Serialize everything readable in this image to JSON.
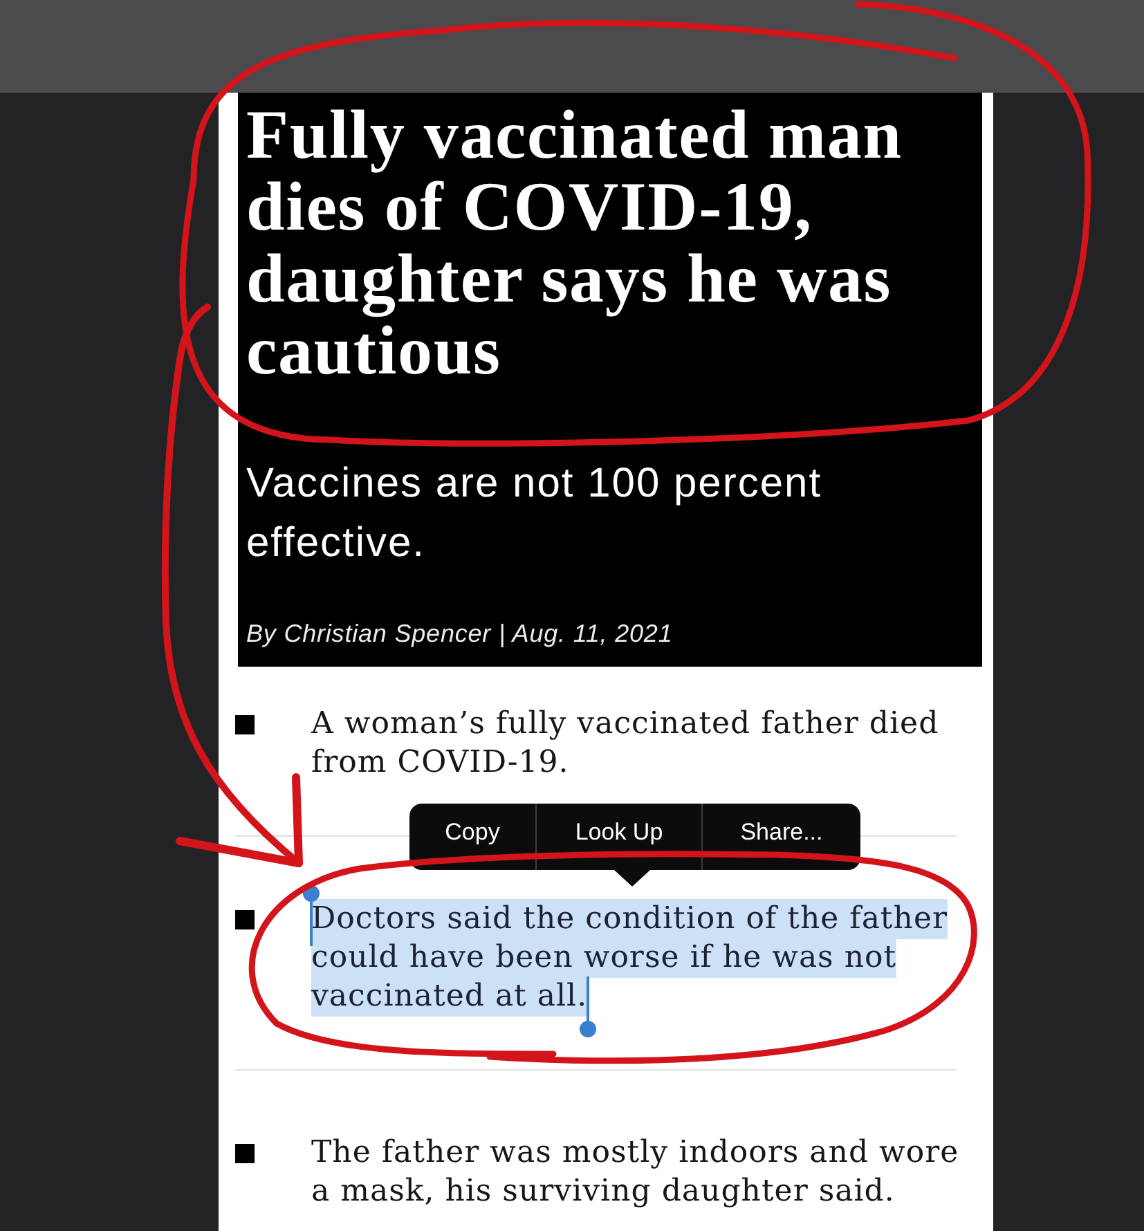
{
  "article": {
    "headline": "Fully vaccinated man dies of COVID-19, daughter says he was cautious",
    "subtitle": "Vaccines are not 100 percent effective.",
    "byline": "By Christian Spencer | Aug. 11, 2021"
  },
  "bullets": [
    {
      "text": "A woman’s fully vaccinated father died from COVID-19.",
      "selected": false
    },
    {
      "text": "Doctors said the condition of the father could have been worse if he was not vaccinated at all.",
      "selected": true
    },
    {
      "text": "The father was mostly indoors and wore a mask, his surviving daughter said.",
      "selected": false
    }
  ],
  "context_menu": {
    "items": [
      "Copy",
      "Look Up",
      "Share..."
    ]
  }
}
